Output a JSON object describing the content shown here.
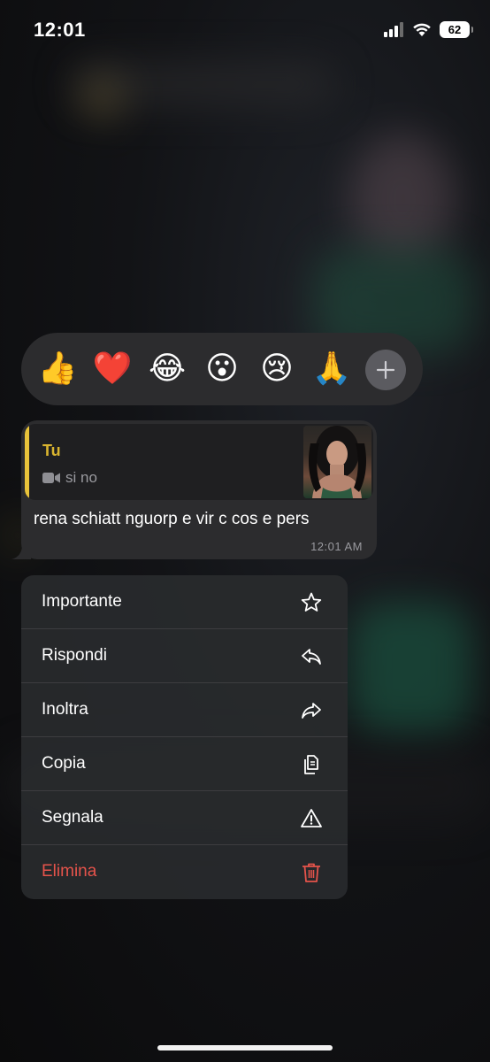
{
  "status_bar": {
    "time": "12:01",
    "battery": "62"
  },
  "reactions": {
    "emojis": [
      "👍",
      "❤️",
      "😂",
      "😮",
      "😢",
      "🙏"
    ],
    "more_icon": "plus-icon"
  },
  "message": {
    "quote_author": "Tu",
    "quote_text": "si no",
    "quote_icon": "video-camera-icon",
    "text": "rena schiatt nguorp e vir c cos e pers",
    "time": "12:01 AM"
  },
  "menu": {
    "items": [
      {
        "label": "Importante",
        "icon": "star-icon"
      },
      {
        "label": "Rispondi",
        "icon": "reply-icon"
      },
      {
        "label": "Inoltra",
        "icon": "forward-icon"
      },
      {
        "label": "Copia",
        "icon": "copy-icon"
      },
      {
        "label": "Segnala",
        "icon": "warning-icon"
      },
      {
        "label": "Elimina",
        "icon": "trash-icon"
      }
    ]
  },
  "colors": {
    "accent_yellow": "#d9b42f",
    "danger": "#e5534b",
    "bubble": "#2c2c2e"
  }
}
